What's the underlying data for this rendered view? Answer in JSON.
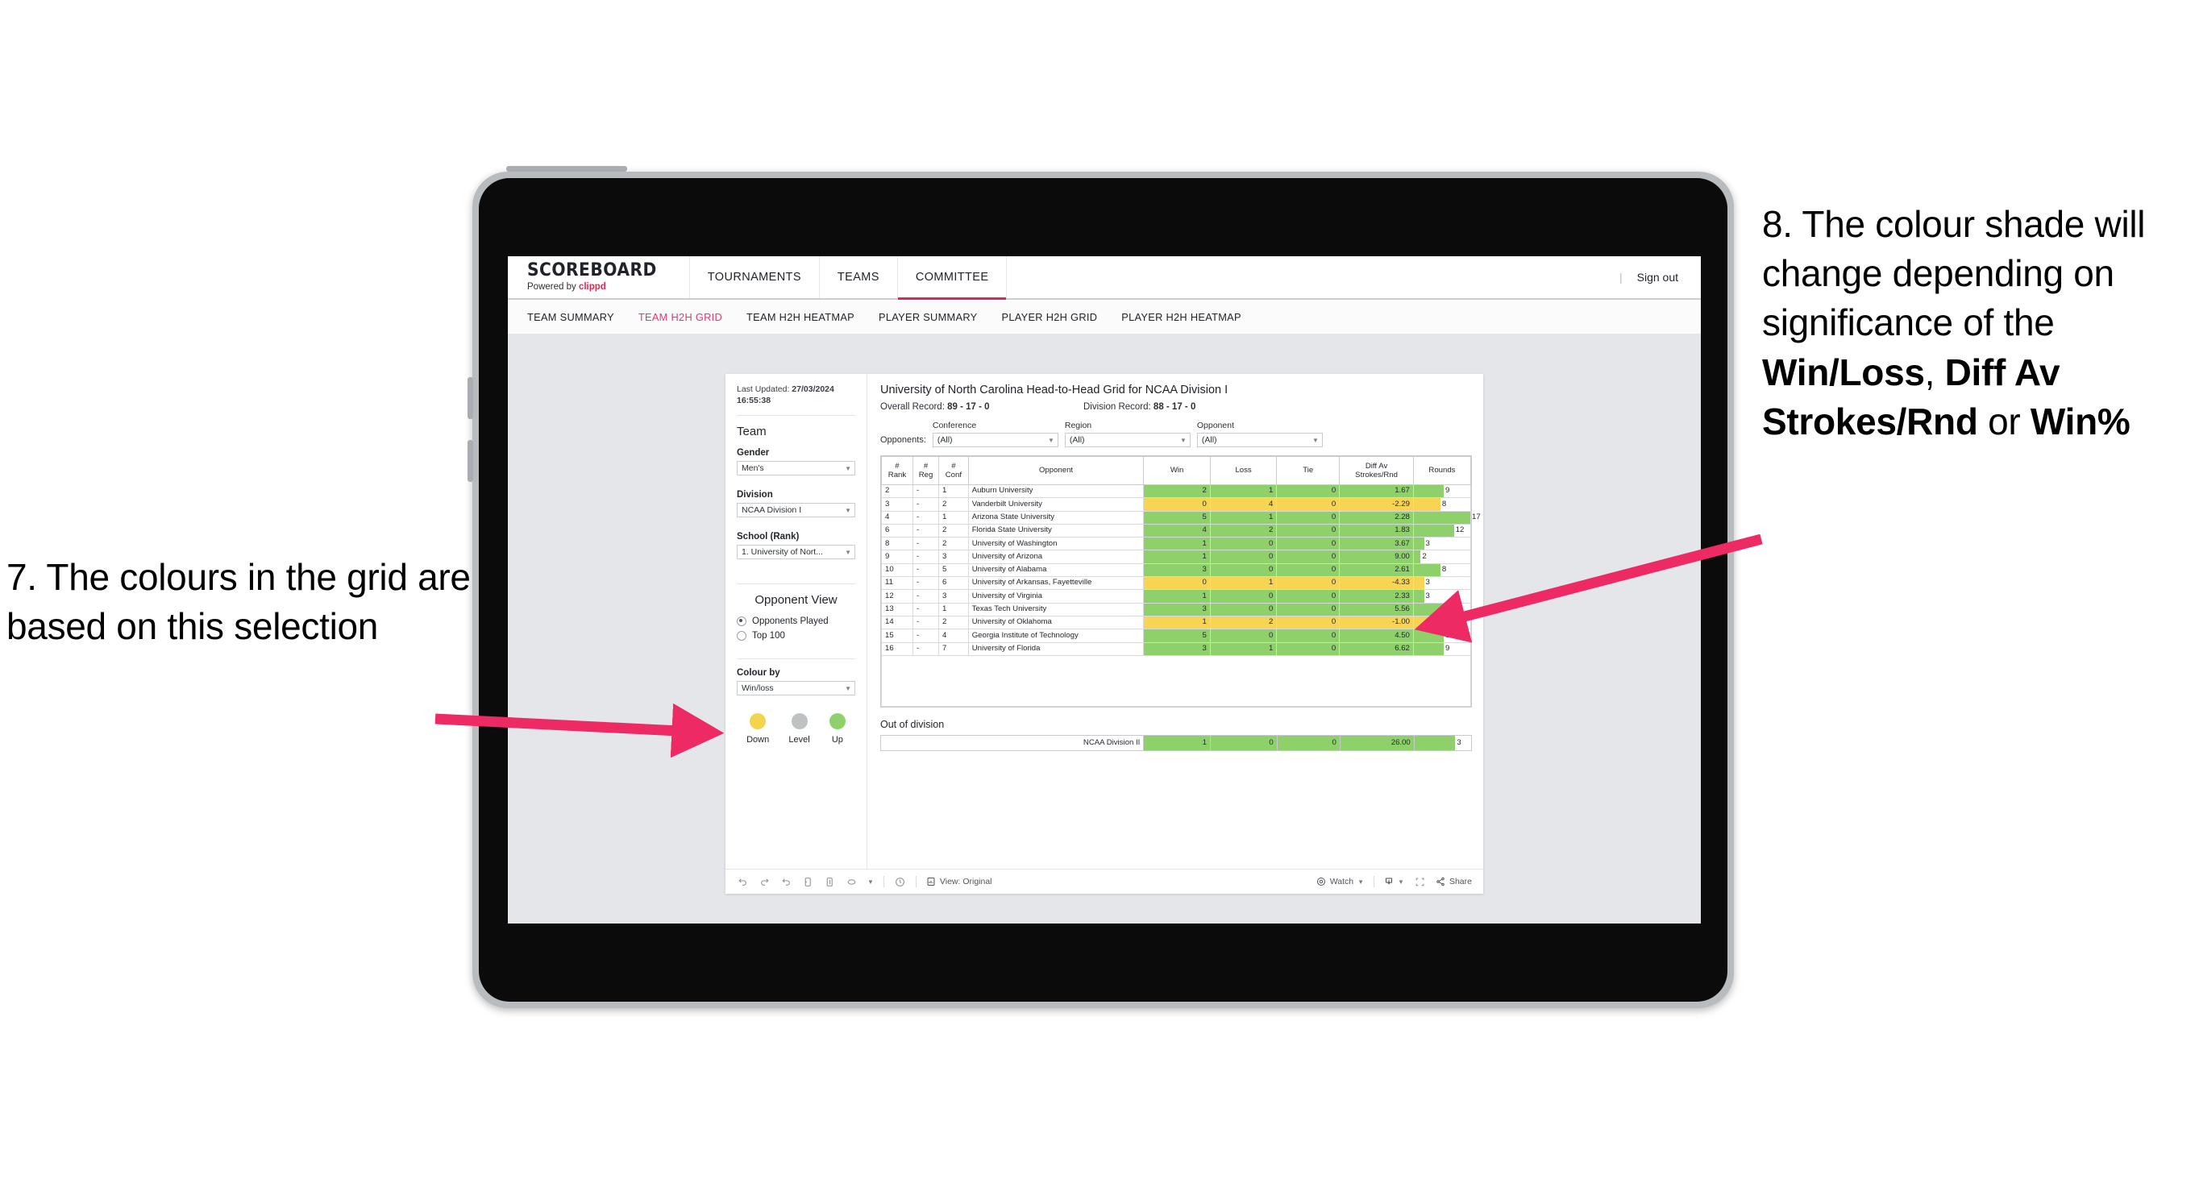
{
  "annotations": {
    "left": {
      "number": "7.",
      "text": "The colours in the grid are based on this selection"
    },
    "right": {
      "number": "8.",
      "part1": "The colour shade will change depending on significance of the ",
      "bold1": "Win/Loss",
      "mid1": ", ",
      "bold2": "Diff Av Strokes/Rnd",
      "mid2": " or ",
      "bold3": "Win%"
    },
    "arrow_color": "#ED2A63"
  },
  "topnav": {
    "brand_name": "SCOREBOARD",
    "brand_sub_prefix": "Powered by ",
    "brand_sub_accent": "clippd",
    "items": [
      {
        "label": "TOURNAMENTS",
        "active": false
      },
      {
        "label": "TEAMS",
        "active": false
      },
      {
        "label": "COMMITTEE",
        "active": true
      }
    ],
    "separator": "|",
    "signout": "Sign out",
    "accent_color": "#E0274F"
  },
  "subnav": {
    "items": [
      {
        "label": "TEAM SUMMARY",
        "active": false
      },
      {
        "label": "TEAM H2H GRID",
        "active": true
      },
      {
        "label": "TEAM H2H HEATMAP",
        "active": false
      },
      {
        "label": "PLAYER SUMMARY",
        "active": false
      },
      {
        "label": "PLAYER H2H GRID",
        "active": false
      },
      {
        "label": "PLAYER H2H HEATMAP",
        "active": false
      }
    ],
    "active_color": "#E8366B"
  },
  "filters": {
    "last_updated_label": "Last Updated: ",
    "last_updated_value": "27/03/2024 16:55:38",
    "team_heading": "Team",
    "gender_label": "Gender",
    "gender_value": "Men's",
    "division_label": "Division",
    "division_value": "NCAA Division I",
    "school_label": "School (Rank)",
    "school_value": "1. University of Nort...",
    "opponent_view_heading": "Opponent View",
    "opponent_view_options": [
      {
        "label": "Opponents Played",
        "selected": true
      },
      {
        "label": "Top 100",
        "selected": false
      }
    ],
    "colour_by_label": "Colour by",
    "colour_by_value": "Win/loss",
    "legend": [
      {
        "label": "Down",
        "color": "#F4D34E"
      },
      {
        "label": "Level",
        "color": "#BFC2C5"
      },
      {
        "label": "Up",
        "color": "#8ED16A"
      }
    ]
  },
  "main": {
    "title": "University of North Carolina Head-to-Head Grid for NCAA Division I",
    "overall_record_label": "Overall Record: ",
    "overall_record_value": "89 - 17 - 0",
    "division_record_label": "Division Record: ",
    "division_record_value": "88 - 17 - 0",
    "opponents_label": "Opponents:",
    "conference_label": "Conference",
    "conference_value": "(All)",
    "region_label": "Region",
    "region_value": "(All)",
    "opponent_label": "Opponent",
    "opponent_value": "(All)",
    "columns": [
      "# Rank",
      "# Reg",
      "# Conf",
      "Opponent",
      "Win",
      "Loss",
      "Tie",
      "Diff Av Strokes/Rnd",
      "Rounds"
    ],
    "out_of_division_title": "Out of division",
    "out_of_division_row": {
      "label": "NCAA Division II",
      "win": "1",
      "loss": "0",
      "tie": "0",
      "diff": "26.00",
      "rounds": "3",
      "color": "green"
    }
  },
  "chart_data": {
    "type": "table",
    "title": "University of North Carolina Head-to-Head Grid for NCAA Division I",
    "columns": [
      "#Rank",
      "#Reg",
      "#Conf",
      "Opponent",
      "Win",
      "Loss",
      "Tie",
      "Diff Av Strokes/Rnd",
      "Rounds"
    ],
    "rounds_max": 17,
    "rows": [
      {
        "rank": "2",
        "reg": "-",
        "conf": "1",
        "opponent": "Auburn University",
        "win": "2",
        "loss": "1",
        "tie": "0",
        "diff": "1.67",
        "rounds": 9,
        "color": "green"
      },
      {
        "rank": "3",
        "reg": "-",
        "conf": "2",
        "opponent": "Vanderbilt University",
        "win": "0",
        "loss": "4",
        "tie": "0",
        "diff": "-2.29",
        "rounds": 8,
        "color": "yellow"
      },
      {
        "rank": "4",
        "reg": "-",
        "conf": "1",
        "opponent": "Arizona State University",
        "win": "5",
        "loss": "1",
        "tie": "0",
        "diff": "2.28",
        "rounds": 17,
        "color": "green"
      },
      {
        "rank": "6",
        "reg": "-",
        "conf": "2",
        "opponent": "Florida State University",
        "win": "4",
        "loss": "2",
        "tie": "0",
        "diff": "1.83",
        "rounds": 12,
        "color": "green"
      },
      {
        "rank": "8",
        "reg": "-",
        "conf": "2",
        "opponent": "University of Washington",
        "win": "1",
        "loss": "0",
        "tie": "0",
        "diff": "3.67",
        "rounds": 3,
        "color": "green"
      },
      {
        "rank": "9",
        "reg": "-",
        "conf": "3",
        "opponent": "University of Arizona",
        "win": "1",
        "loss": "0",
        "tie": "0",
        "diff": "9.00",
        "rounds": 2,
        "color": "green"
      },
      {
        "rank": "10",
        "reg": "-",
        "conf": "5",
        "opponent": "University of Alabama",
        "win": "3",
        "loss": "0",
        "tie": "0",
        "diff": "2.61",
        "rounds": 8,
        "color": "green"
      },
      {
        "rank": "11",
        "reg": "-",
        "conf": "6",
        "opponent": "University of Arkansas, Fayetteville",
        "win": "0",
        "loss": "1",
        "tie": "0",
        "diff": "-4.33",
        "rounds": 3,
        "color": "yellow"
      },
      {
        "rank": "12",
        "reg": "-",
        "conf": "3",
        "opponent": "University of Virginia",
        "win": "1",
        "loss": "0",
        "tie": "0",
        "diff": "2.33",
        "rounds": 3,
        "color": "green"
      },
      {
        "rank": "13",
        "reg": "-",
        "conf": "1",
        "opponent": "Texas Tech University",
        "win": "3",
        "loss": "0",
        "tie": "0",
        "diff": "5.56",
        "rounds": 9,
        "color": "green"
      },
      {
        "rank": "14",
        "reg": "-",
        "conf": "2",
        "opponent": "University of Oklahoma",
        "win": "1",
        "loss": "2",
        "tie": "0",
        "diff": "-1.00",
        "rounds": 9,
        "color": "yellow"
      },
      {
        "rank": "15",
        "reg": "-",
        "conf": "4",
        "opponent": "Georgia Institute of Technology",
        "win": "5",
        "loss": "0",
        "tie": "0",
        "diff": "4.50",
        "rounds": 9,
        "color": "green"
      },
      {
        "rank": "16",
        "reg": "-",
        "conf": "7",
        "opponent": "University of Florida",
        "win": "3",
        "loss": "1",
        "tie": "0",
        "diff": "6.62",
        "rounds": 9,
        "color": "green"
      }
    ],
    "colors": {
      "green": "#8ED16A",
      "yellow": "#F7D453"
    }
  },
  "vizbar": {
    "view_label": "View: Original",
    "watch_label": "Watch",
    "share_label": "Share"
  }
}
